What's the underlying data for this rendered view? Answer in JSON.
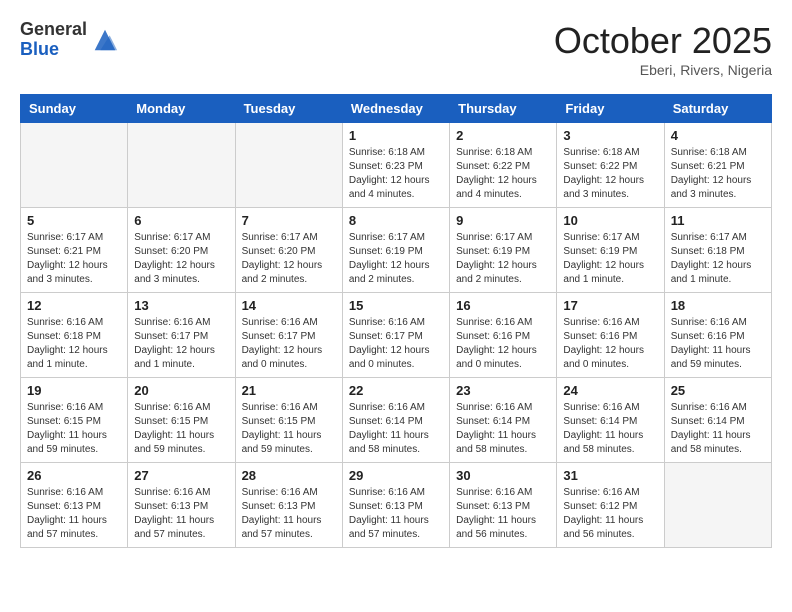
{
  "header": {
    "logo_general": "General",
    "logo_blue": "Blue",
    "month_title": "October 2025",
    "subtitle": "Eberi, Rivers, Nigeria"
  },
  "weekdays": [
    "Sunday",
    "Monday",
    "Tuesday",
    "Wednesday",
    "Thursday",
    "Friday",
    "Saturday"
  ],
  "weeks": [
    [
      {
        "day": "",
        "info": ""
      },
      {
        "day": "",
        "info": ""
      },
      {
        "day": "",
        "info": ""
      },
      {
        "day": "1",
        "info": "Sunrise: 6:18 AM\nSunset: 6:23 PM\nDaylight: 12 hours\nand 4 minutes."
      },
      {
        "day": "2",
        "info": "Sunrise: 6:18 AM\nSunset: 6:22 PM\nDaylight: 12 hours\nand 4 minutes."
      },
      {
        "day": "3",
        "info": "Sunrise: 6:18 AM\nSunset: 6:22 PM\nDaylight: 12 hours\nand 3 minutes."
      },
      {
        "day": "4",
        "info": "Sunrise: 6:18 AM\nSunset: 6:21 PM\nDaylight: 12 hours\nand 3 minutes."
      }
    ],
    [
      {
        "day": "5",
        "info": "Sunrise: 6:17 AM\nSunset: 6:21 PM\nDaylight: 12 hours\nand 3 minutes."
      },
      {
        "day": "6",
        "info": "Sunrise: 6:17 AM\nSunset: 6:20 PM\nDaylight: 12 hours\nand 3 minutes."
      },
      {
        "day": "7",
        "info": "Sunrise: 6:17 AM\nSunset: 6:20 PM\nDaylight: 12 hours\nand 2 minutes."
      },
      {
        "day": "8",
        "info": "Sunrise: 6:17 AM\nSunset: 6:19 PM\nDaylight: 12 hours\nand 2 minutes."
      },
      {
        "day": "9",
        "info": "Sunrise: 6:17 AM\nSunset: 6:19 PM\nDaylight: 12 hours\nand 2 minutes."
      },
      {
        "day": "10",
        "info": "Sunrise: 6:17 AM\nSunset: 6:19 PM\nDaylight: 12 hours\nand 1 minute."
      },
      {
        "day": "11",
        "info": "Sunrise: 6:17 AM\nSunset: 6:18 PM\nDaylight: 12 hours\nand 1 minute."
      }
    ],
    [
      {
        "day": "12",
        "info": "Sunrise: 6:16 AM\nSunset: 6:18 PM\nDaylight: 12 hours\nand 1 minute."
      },
      {
        "day": "13",
        "info": "Sunrise: 6:16 AM\nSunset: 6:17 PM\nDaylight: 12 hours\nand 1 minute."
      },
      {
        "day": "14",
        "info": "Sunrise: 6:16 AM\nSunset: 6:17 PM\nDaylight: 12 hours\nand 0 minutes."
      },
      {
        "day": "15",
        "info": "Sunrise: 6:16 AM\nSunset: 6:17 PM\nDaylight: 12 hours\nand 0 minutes."
      },
      {
        "day": "16",
        "info": "Sunrise: 6:16 AM\nSunset: 6:16 PM\nDaylight: 12 hours\nand 0 minutes."
      },
      {
        "day": "17",
        "info": "Sunrise: 6:16 AM\nSunset: 6:16 PM\nDaylight: 12 hours\nand 0 minutes."
      },
      {
        "day": "18",
        "info": "Sunrise: 6:16 AM\nSunset: 6:16 PM\nDaylight: 11 hours\nand 59 minutes."
      }
    ],
    [
      {
        "day": "19",
        "info": "Sunrise: 6:16 AM\nSunset: 6:15 PM\nDaylight: 11 hours\nand 59 minutes."
      },
      {
        "day": "20",
        "info": "Sunrise: 6:16 AM\nSunset: 6:15 PM\nDaylight: 11 hours\nand 59 minutes."
      },
      {
        "day": "21",
        "info": "Sunrise: 6:16 AM\nSunset: 6:15 PM\nDaylight: 11 hours\nand 59 minutes."
      },
      {
        "day": "22",
        "info": "Sunrise: 6:16 AM\nSunset: 6:14 PM\nDaylight: 11 hours\nand 58 minutes."
      },
      {
        "day": "23",
        "info": "Sunrise: 6:16 AM\nSunset: 6:14 PM\nDaylight: 11 hours\nand 58 minutes."
      },
      {
        "day": "24",
        "info": "Sunrise: 6:16 AM\nSunset: 6:14 PM\nDaylight: 11 hours\nand 58 minutes."
      },
      {
        "day": "25",
        "info": "Sunrise: 6:16 AM\nSunset: 6:14 PM\nDaylight: 11 hours\nand 58 minutes."
      }
    ],
    [
      {
        "day": "26",
        "info": "Sunrise: 6:16 AM\nSunset: 6:13 PM\nDaylight: 11 hours\nand 57 minutes."
      },
      {
        "day": "27",
        "info": "Sunrise: 6:16 AM\nSunset: 6:13 PM\nDaylight: 11 hours\nand 57 minutes."
      },
      {
        "day": "28",
        "info": "Sunrise: 6:16 AM\nSunset: 6:13 PM\nDaylight: 11 hours\nand 57 minutes."
      },
      {
        "day": "29",
        "info": "Sunrise: 6:16 AM\nSunset: 6:13 PM\nDaylight: 11 hours\nand 57 minutes."
      },
      {
        "day": "30",
        "info": "Sunrise: 6:16 AM\nSunset: 6:13 PM\nDaylight: 11 hours\nand 56 minutes."
      },
      {
        "day": "31",
        "info": "Sunrise: 6:16 AM\nSunset: 6:12 PM\nDaylight: 11 hours\nand 56 minutes."
      },
      {
        "day": "",
        "info": ""
      }
    ]
  ]
}
